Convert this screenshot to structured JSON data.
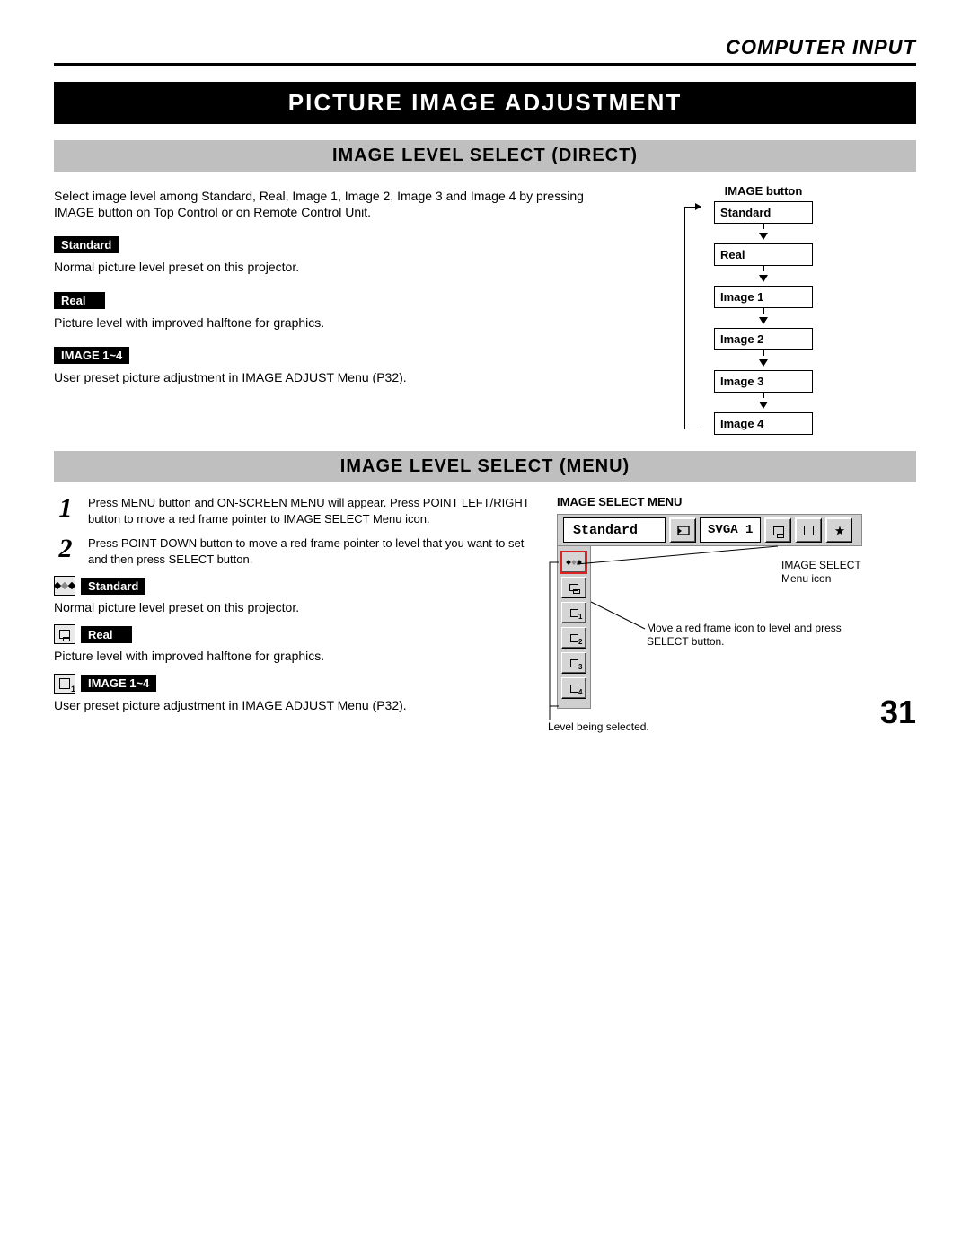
{
  "chapter": "COMPUTER INPUT",
  "title": "PICTURE IMAGE ADJUSTMENT",
  "section_direct": "IMAGE LEVEL SELECT (DIRECT)",
  "section_menu": "IMAGE LEVEL SELECT (MENU)",
  "direct_intro": "Select image level among Standard, Real, Image 1, Image 2, Image 3 and Image 4 by pressing IMAGE button on Top Control or on Remote Control Unit.",
  "labels": {
    "standard": "Standard",
    "real": "Real",
    "image14": "IMAGE 1~4"
  },
  "desc": {
    "standard": "Normal picture level preset on this projector.",
    "real": "Picture level with improved halftone for graphics.",
    "image14": "User preset picture adjustment in IMAGE ADJUST Menu (P32)."
  },
  "flow": {
    "title": "IMAGE button",
    "items": [
      "Standard",
      "Real",
      "Image 1",
      "Image 2",
      "Image 3",
      "Image 4"
    ]
  },
  "steps": {
    "s1": "Press MENU button and ON-SCREEN MENU will appear.  Press POINT LEFT/RIGHT button to move a red frame pointer to IMAGE SELECT Menu icon.",
    "s2": "Press POINT DOWN button to move a red frame pointer to level that you want to set and then press SELECT button."
  },
  "menu_block": {
    "title": "IMAGE SELECT MENU",
    "current_name": "Standard",
    "resolution": "SVGA 1",
    "annot_icon": "IMAGE SELECT Menu icon",
    "annot_move": "Move a red frame icon to level and press SELECT button.",
    "annot_level": "Level being selected."
  },
  "page_number": "31"
}
